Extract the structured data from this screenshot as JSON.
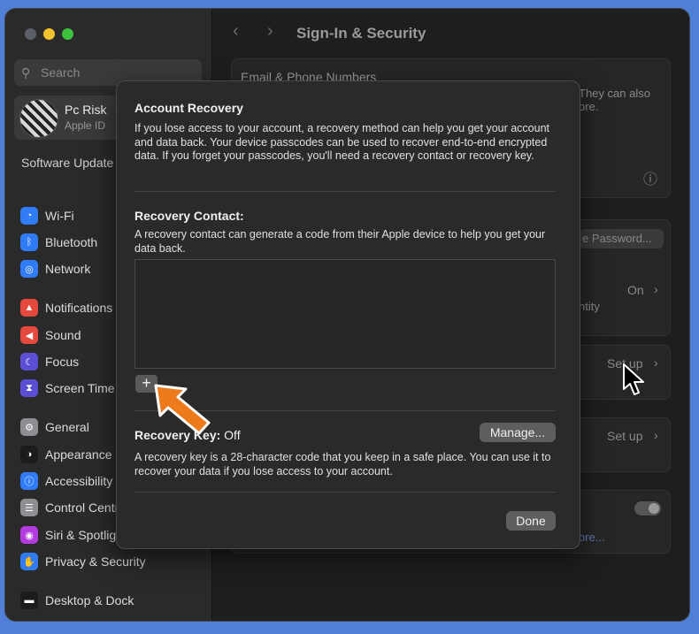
{
  "sidebar": {
    "search_placeholder": "Search",
    "account_name": "Pc Risk",
    "account_sub": "Apple ID",
    "software_update": "Software Update Available",
    "items": [
      {
        "label": "Wi-Fi",
        "icon": "wifi-icon",
        "color": "#2f7cf6"
      },
      {
        "label": "Bluetooth",
        "icon": "bluetooth-icon",
        "color": "#2f7cf6"
      },
      {
        "label": "Network",
        "icon": "globe-icon",
        "color": "#2f7cf6"
      },
      {
        "label": "Notifications",
        "icon": "bell-icon",
        "color": "#e5483d"
      },
      {
        "label": "Sound",
        "icon": "speaker-icon",
        "color": "#e5483d"
      },
      {
        "label": "Focus",
        "icon": "moon-icon",
        "color": "#5b4fd6"
      },
      {
        "label": "Screen Time",
        "icon": "hourglass-icon",
        "color": "#5b4fd6"
      },
      {
        "label": "General",
        "icon": "gear-icon",
        "color": "#8e8e93"
      },
      {
        "label": "Appearance",
        "icon": "appearance-icon",
        "color": "#1c1c1c"
      },
      {
        "label": "Accessibility",
        "icon": "accessibility-icon",
        "color": "#2f7cf6"
      },
      {
        "label": "Control Centre",
        "icon": "control-centre-icon",
        "color": "#8e8e93"
      },
      {
        "label": "Siri & Spotlight",
        "icon": "siri-icon",
        "color": "#b33be0"
      },
      {
        "label": "Privacy & Security",
        "icon": "hand-icon",
        "color": "#2f7cf6"
      },
      {
        "label": "Desktop & Dock",
        "icon": "dock-icon",
        "color": "#1c1c1c"
      }
    ]
  },
  "content": {
    "title": "Sign-In & Security",
    "email_section": "Email & Phone Numbers",
    "email_desc_1": "They can also",
    "email_desc_2": "ore.",
    "password_button": "e Password...",
    "two_factor_value": "On",
    "two_factor_desc": "ntity",
    "setup_1": "Set up",
    "setup_2": "Set up",
    "more_link": "ore..."
  },
  "dialog": {
    "title": "Account Recovery",
    "intro": "If you lose access to your account, a recovery method can help you get your account and data back. Your device passcodes can be used to recover end-to-end encrypted data. If you forget your passcodes, you'll need a recovery contact or recovery key.",
    "contact_heading": "Recovery Contact:",
    "contact_desc": "A recovery contact can generate a code from their Apple device to help you get your data back.",
    "add_symbol": "+",
    "key_label": "Recovery Key:",
    "key_value": "Off",
    "manage_button": "Manage...",
    "key_desc": "A recovery key is a 28-character code that you keep in a safe place. You can use it to recover your data if you lose access to your account.",
    "done_button": "Done"
  }
}
